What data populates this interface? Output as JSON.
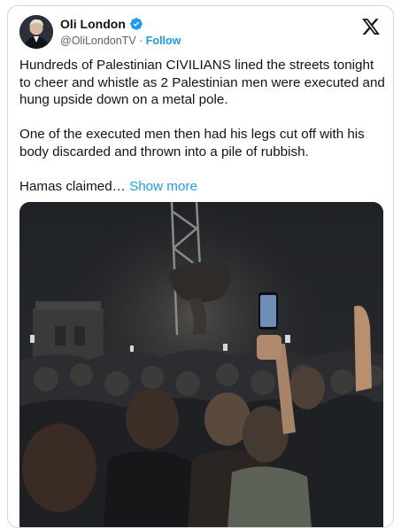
{
  "author": {
    "display_name": "Oli London",
    "handle": "@OliLondonTV",
    "separator": "·",
    "follow_label": "Follow",
    "verified": true,
    "verified_color": "#1d9bf0"
  },
  "platform_icon": "x-logo-icon",
  "tweet": {
    "paragraphs": [
      "Hundreds of Palestinian CIVILIANS lined the streets tonight to cheer and whistle as 2 Palestinian men were executed and hung upside down on a metal pole.",
      "One of the executed men then had his legs cut off with his body discarded and thrown into a pile of rubbish."
    ],
    "truncated_text": "Hamas claimed…",
    "show_more_label": "Show more"
  },
  "colors": {
    "text_primary": "#0f1419",
    "text_secondary": "#536471",
    "accent": "#1d9bf0",
    "border": "#cfd9de"
  }
}
